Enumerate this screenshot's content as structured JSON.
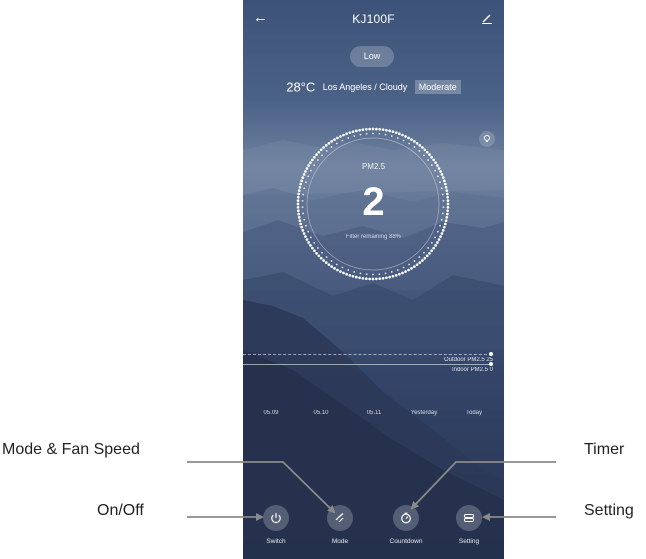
{
  "header": {
    "title": "KJ100F"
  },
  "fan_speed": "Low",
  "weather": {
    "temperature": "28°C",
    "location_condition": "Los Angeles / Cloudy",
    "air_quality": "Moderate"
  },
  "gauge": {
    "label": "PM2.5",
    "value": "2",
    "filter_text": "Filter remaining 88%",
    "filter_remaining_percent": 88
  },
  "chart": {
    "outdoor_label": "Outdoor PM2.5 25",
    "indoor_label": "Indoor PM2.5 0",
    "dates": [
      "05.09",
      "05.10",
      "05.11",
      "Yesterday",
      "Today"
    ]
  },
  "controls": [
    {
      "label": "Switch",
      "icon": "power-icon"
    },
    {
      "label": "Mode",
      "icon": "fan-speed-icon"
    },
    {
      "label": "Countdown",
      "icon": "timer-icon"
    },
    {
      "label": "Setting",
      "icon": "settings-icon"
    }
  ],
  "callouts": {
    "mode": "Mode & Fan Speed",
    "onoff": "On/Off",
    "timer": "Timer",
    "setting": "Setting"
  },
  "colors": {
    "sky_top": "#3d5278",
    "mist": "#6e819f",
    "night": "#26344f",
    "foreground": "#ffffff"
  }
}
